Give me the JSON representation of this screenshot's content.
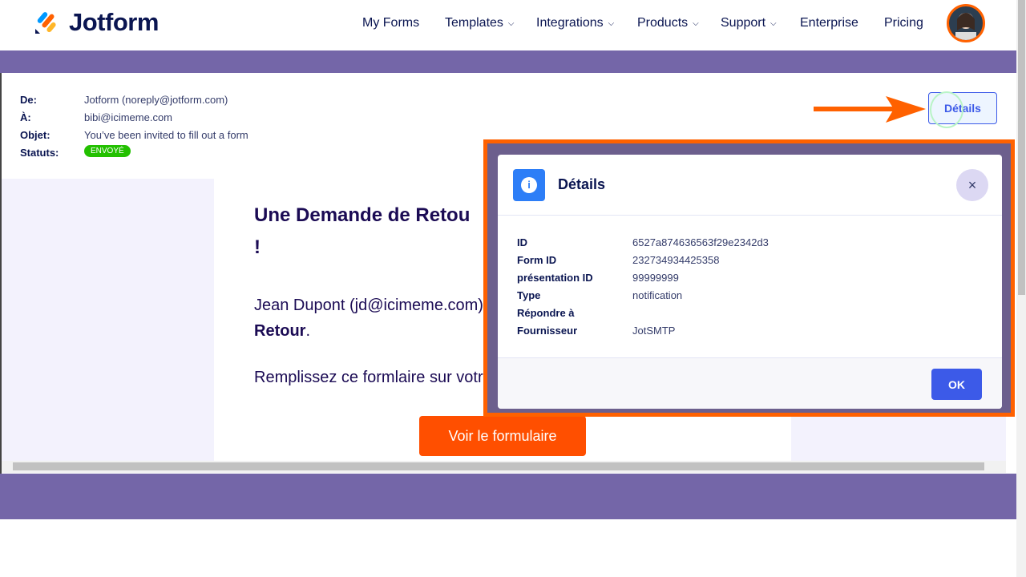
{
  "header": {
    "logo": "Jotform",
    "nav": [
      {
        "label": "My Forms",
        "dropdown": false
      },
      {
        "label": "Templates",
        "dropdown": true
      },
      {
        "label": "Integrations",
        "dropdown": true
      },
      {
        "label": "Products",
        "dropdown": true
      },
      {
        "label": "Support",
        "dropdown": true
      },
      {
        "label": "Enterprise",
        "dropdown": false
      },
      {
        "label": "Pricing",
        "dropdown": false
      }
    ]
  },
  "email": {
    "from_label": "De:",
    "from": "Jotform (noreply@jotform.com)",
    "to_label": "À:",
    "to": "bibi@icimeme.com",
    "subject_label": "Objet:",
    "subject": "You’ve been invited to fill out a form",
    "status_label": "Statuts:",
    "status": "ENVOYÉ",
    "details_button": "Détails"
  },
  "body": {
    "title": "Une Demande de Retou",
    "title_end": "!",
    "line1": "Jean Dupont (jd@icimeme.com)",
    "line1_bold": "Retour",
    "line1_end": ".",
    "line2": "Remplissez ce formlaire sur votr",
    "cta": "Voir le formulaire"
  },
  "modal": {
    "title": "Détails",
    "close": "×",
    "rows": [
      {
        "key": "ID",
        "value": "6527a874636563f29e2342d3"
      },
      {
        "key": "Form ID",
        "value": "232734934425358"
      },
      {
        "key": "présentation ID",
        "value": "99999999"
      },
      {
        "key": "Type",
        "value": "notification"
      },
      {
        "key": "Répondre à",
        "value": ""
      },
      {
        "key": "Fournisseur",
        "value": "JotSMTP"
      }
    ],
    "ok": "OK"
  },
  "colors": {
    "accent": "#ff6100",
    "primary": "#3c5ae8",
    "purple": "#7466a8",
    "success": "#23c000"
  }
}
